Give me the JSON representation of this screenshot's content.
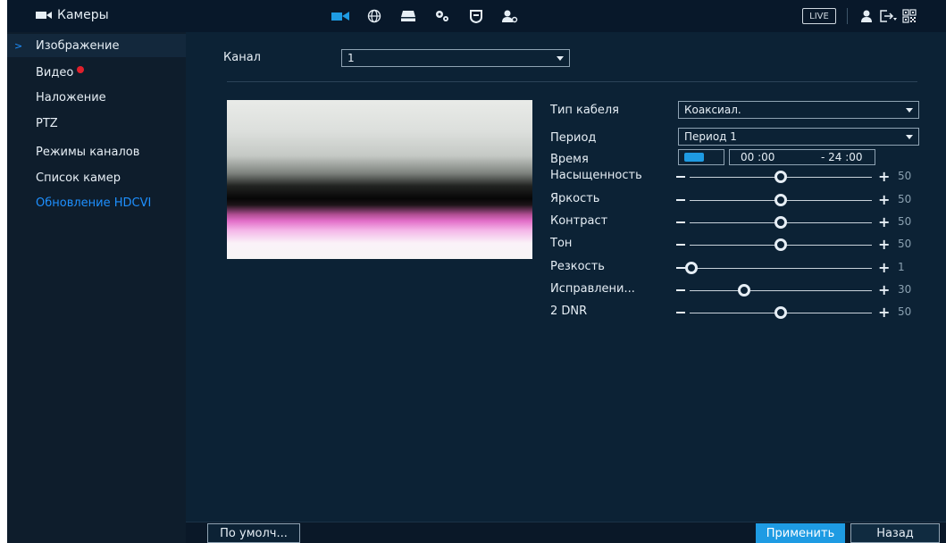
{
  "topbar": {
    "title": "Камеры",
    "nav_icons": [
      "camera-icon",
      "globe-icon",
      "storage-icon",
      "settings-icon",
      "shield-icon",
      "user-settings-icon"
    ],
    "live_label": "LIVE",
    "right_icons": [
      "user-icon",
      "logout-icon",
      "qr-code-icon"
    ],
    "accent_color": "#1e9be3"
  },
  "sidebar": {
    "items": [
      {
        "label": "Изображение",
        "active": true
      },
      {
        "label": "Видео",
        "badge": true
      },
      {
        "label": "Наложение"
      },
      {
        "label": "PTZ"
      },
      {
        "label": "Режимы каналов"
      },
      {
        "label": "Список камер"
      },
      {
        "label": "Обновление HDCVI",
        "color": "#1e90ff"
      }
    ]
  },
  "main": {
    "channel_label": "Канал",
    "channel_value": "1",
    "cable_type_label": "Тип кабеля",
    "cable_type_value": "Коаксиал.",
    "period_label": "Период",
    "period_value": "Период 1",
    "time_label": "Время",
    "time_toggle_on": true,
    "time_start": "00 :00",
    "time_end": "- 24 :00",
    "sliders": [
      {
        "label": "Насыщенность",
        "value": "50",
        "level": 50
      },
      {
        "label": "Яркость",
        "value": "50",
        "level": 50
      },
      {
        "label": "Контраст",
        "value": "50",
        "level": 50
      },
      {
        "label": "Тон",
        "value": "50",
        "level": 50
      },
      {
        "label": "Резкость",
        "value": "1",
        "level": 1
      },
      {
        "label": "Исправлени...",
        "value": "30",
        "level": 30
      },
      {
        "label": "2 DNR",
        "value": "50",
        "level": 50
      }
    ]
  },
  "buttons": {
    "default_label": "По умолч...",
    "apply_label": "Применить",
    "back_label": "Назад"
  }
}
